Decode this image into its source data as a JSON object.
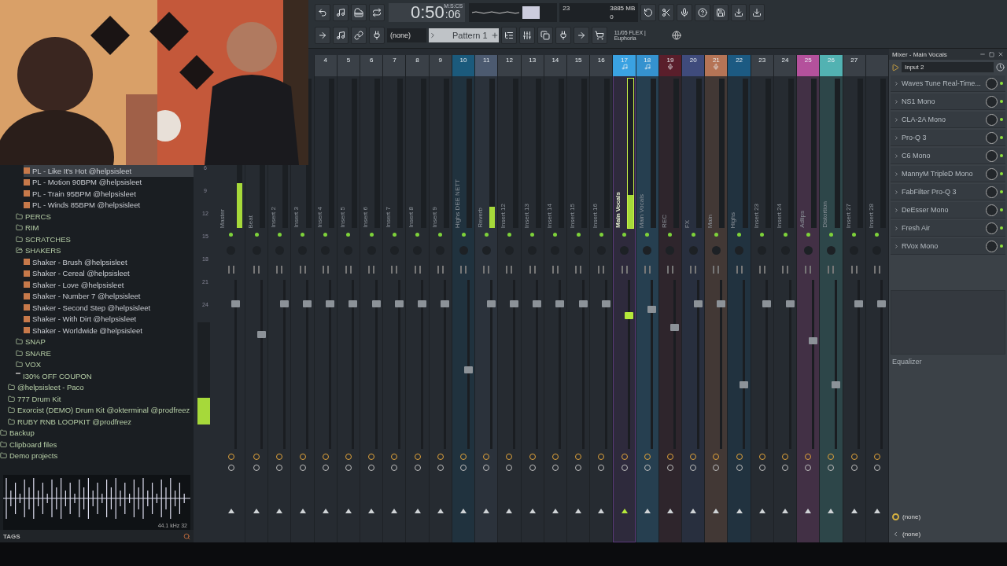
{
  "toolbar": {
    "time": {
      "main": "0:50",
      "sub": ":06",
      "unit": "M:S:CS"
    },
    "cpu": {
      "voices": "23",
      "memory": "3885 MB",
      "polyphony": "0"
    },
    "pattern_selector": {
      "value": "(none)"
    },
    "pattern": "Pattern 1",
    "news": {
      "date": "11/05 FLEX |",
      "title": "Euphoria"
    }
  },
  "browser": {
    "tree": [
      {
        "children": [
          {
            "children": [
              {
                "children": [
                  {
                    "label": "PL - Like It's Hot @helpsisleet",
                    "kind": "file",
                    "selected": true
                  },
                  {
                    "label": "PL - Motion 90BPM @helpsisleet",
                    "kind": "file",
                    "selected": false
                  },
                  {
                    "label": "PL - Train 95BPM @helpsisleet",
                    "kind": "file",
                    "selected": false
                  },
                  {
                    "label": "PL - Winds 85BPM @helpsisleet",
                    "kind": "file",
                    "selected": false
                  }
                ]
              },
              {
                "label": "PERCS",
                "kind": "folder",
                "selected": false
              },
              {
                "label": "RIM",
                "kind": "folder",
                "selected": false
              },
              {
                "label": "SCRATCHES",
                "kind": "folder",
                "selected": false
              },
              {
                "label": "SHAKERS",
                "kind": "folder",
                "selected": false,
                "children": [
                  {
                    "label": "Shaker - Brush @helpsisleet",
                    "kind": "file",
                    "selected": false
                  },
                  {
                    "label": "Shaker - Cereal @helpsisleet",
                    "kind": "file",
                    "selected": false
                  },
                  {
                    "label": "Shaker - Love @helpsisleet",
                    "kind": "file",
                    "selected": false
                  },
                  {
                    "label": "Shaker - Number 7 @helpsisleet",
                    "kind": "file",
                    "selected": false
                  },
                  {
                    "label": "Shaker - Second Step @helpsisleet",
                    "kind": "file",
                    "selected": false
                  },
                  {
                    "label": "Shaker - With Dirt @helpsisleet",
                    "kind": "file",
                    "selected": false
                  },
                  {
                    "label": "Shaker - Worldwide @helpsisleet",
                    "kind": "file",
                    "selected": false
                  }
                ]
              },
              {
                "label": "SNAP",
                "kind": "folder",
                "selected": false
              },
              {
                "label": "SNARE",
                "kind": "folder",
                "selected": false
              },
              {
                "label": "VOX",
                "kind": "folder",
                "selected": false
              },
              {
                "label": "I30% OFF COUPON",
                "kind": "text",
                "selected": false
              }
            ]
          },
          {
            "label": "@helpsisleet - Paco",
            "kind": "folder",
            "selected": false
          },
          {
            "label": "777 Drum Kit",
            "kind": "folder",
            "selected": false
          },
          {
            "label": "Exorcist (DEMO) Drum Kit @okterminal @prodfreez",
            "kind": "folder",
            "selected": false
          },
          {
            "label": "RUBY RNB LOOPKIT @prodfreez",
            "kind": "folder",
            "selected": false
          }
        ]
      },
      {
        "label": "Backup",
        "kind": "folder",
        "selected": false
      },
      {
        "label": "Clipboard files",
        "kind": "folder",
        "selected": false
      },
      {
        "label": "Demo projects",
        "kind": "folder",
        "selected": false
      }
    ],
    "sample_info": "44.1 kHz 32",
    "tags": "TAGS"
  },
  "mixer": {
    "scale": [
      "6",
      "9",
      "12",
      "15",
      "18",
      "21",
      "24"
    ],
    "master_meter": {
      "level": 0.26
    },
    "strips": [
      {
        "name": "Master",
        "selected": false,
        "fader": {
          "level": 0.86
        },
        "meter": {
          "level": 0.3
        }
      },
      {
        "name": "Beat",
        "selected": false,
        "fader": {
          "level": 0.68
        }
      },
      {
        "name": "Insert 2",
        "selected": false,
        "fader": {
          "level": 0.86
        }
      },
      {
        "name": "Insert 3",
        "selected": false,
        "fader": {
          "level": 0.86
        }
      },
      {
        "number": "4",
        "name": "Insert 4",
        "selected": false,
        "fader": {
          "level": 0.86
        }
      },
      {
        "number": "5",
        "name": "Insert 5",
        "selected": false,
        "fader": {
          "level": 0.86
        }
      },
      {
        "number": "6",
        "name": "Insert 6",
        "selected": false,
        "fader": {
          "level": 0.86
        }
      },
      {
        "number": "7",
        "name": "Insert 7",
        "selected": false,
        "fader": {
          "level": 0.86
        }
      },
      {
        "number": "8",
        "name": "Insert 8",
        "selected": false,
        "fader": {
          "level": 0.86
        }
      },
      {
        "number": "9",
        "name": "Insert 9",
        "selected": false,
        "fader": {
          "level": 0.86
        }
      },
      {
        "number": "10",
        "name": "Highs DEE NETT",
        "color": "#1b5a7c",
        "selected": false,
        "fader": {
          "level": 0.47
        }
      },
      {
        "number": "11",
        "name": "Reverb",
        "color": "#4c5a70",
        "selected": false,
        "fader": {
          "level": 0.86
        },
        "meter": {
          "level": 0.14
        }
      },
      {
        "number": "12",
        "name": "Insert 12",
        "selected": false,
        "fader": {
          "level": 0.86
        }
      },
      {
        "number": "13",
        "name": "Insert 13",
        "selected": false,
        "fader": {
          "level": 0.86
        }
      },
      {
        "number": "14",
        "name": "Insert 14",
        "selected": false,
        "fader": {
          "level": 0.86
        }
      },
      {
        "number": "15",
        "name": "Insert 15",
        "selected": false,
        "fader": {
          "level": 0.86
        }
      },
      {
        "number": "16",
        "name": "Insert 16",
        "selected": false,
        "fader": {
          "level": 0.86
        }
      },
      {
        "number": "17",
        "name": "Main Vocals",
        "color": "#3aa2e2",
        "kind": "note",
        "selected": true,
        "fader": {
          "level": 0.79
        },
        "meter": {
          "level": 0.22
        }
      },
      {
        "number": "18",
        "name": "Main Vocals",
        "color": "#3592cf",
        "kind": "note",
        "selected": false,
        "fader": {
          "level": 0.83
        }
      },
      {
        "number": "19",
        "name": "REC",
        "color": "#5a1e2b",
        "kind": "mic",
        "selected": false,
        "fader": {
          "level": 0.72
        }
      },
      {
        "number": "20",
        "name": "FX",
        "color": "#3f4b7c",
        "selected": false,
        "fader": {
          "level": 0.86
        }
      },
      {
        "number": "21",
        "name": "Main",
        "color": "#b57456",
        "kind": "mic",
        "selected": false,
        "fader": {
          "level": 0.86
        }
      },
      {
        "number": "22",
        "name": "Highs",
        "color": "#1c5a82",
        "selected": false,
        "fader": {
          "level": 0.38
        }
      },
      {
        "number": "23",
        "name": "Insert 23",
        "selected": false,
        "fader": {
          "level": 0.86
        }
      },
      {
        "number": "24",
        "name": "Insert 24",
        "selected": false,
        "fader": {
          "level": 0.86
        }
      },
      {
        "number": "25",
        "name": "Adlips",
        "color": "#b4519c",
        "selected": false,
        "fader": {
          "level": 0.64
        }
      },
      {
        "number": "26",
        "name": "Distortion",
        "color": "#52b2b2",
        "selected": false,
        "fader": {
          "level": 0.38
        }
      },
      {
        "number": "27",
        "name": "Insert 27",
        "selected": false,
        "fader": {
          "level": 0.86
        }
      },
      {
        "name": "Insert 28",
        "selected": false,
        "fader": {
          "level": 0.86
        }
      }
    ]
  },
  "inspector": {
    "title": "Mixer - Main Vocals",
    "input": "Input 2",
    "slots": [
      {
        "name": "Waves Tune Real-Time...",
        "on": true
      },
      {
        "name": "NS1 Mono",
        "on": true
      },
      {
        "name": "CLA-2A Mono",
        "on": true
      },
      {
        "name": "Pro-Q 3",
        "on": true
      },
      {
        "name": "C6 Mono",
        "on": true
      },
      {
        "name": "MannyM TripleD Mono",
        "on": true
      },
      {
        "name": "FabFilter Pro-Q 3",
        "on": true
      },
      {
        "name": "DeEsser Mono",
        "on": true
      },
      {
        "name": "Fresh Air",
        "on": true
      },
      {
        "name": "RVox Mono",
        "on": true
      }
    ],
    "equalizer": "Equalizer",
    "fx_out": "(none)",
    "output": "(none)"
  }
}
